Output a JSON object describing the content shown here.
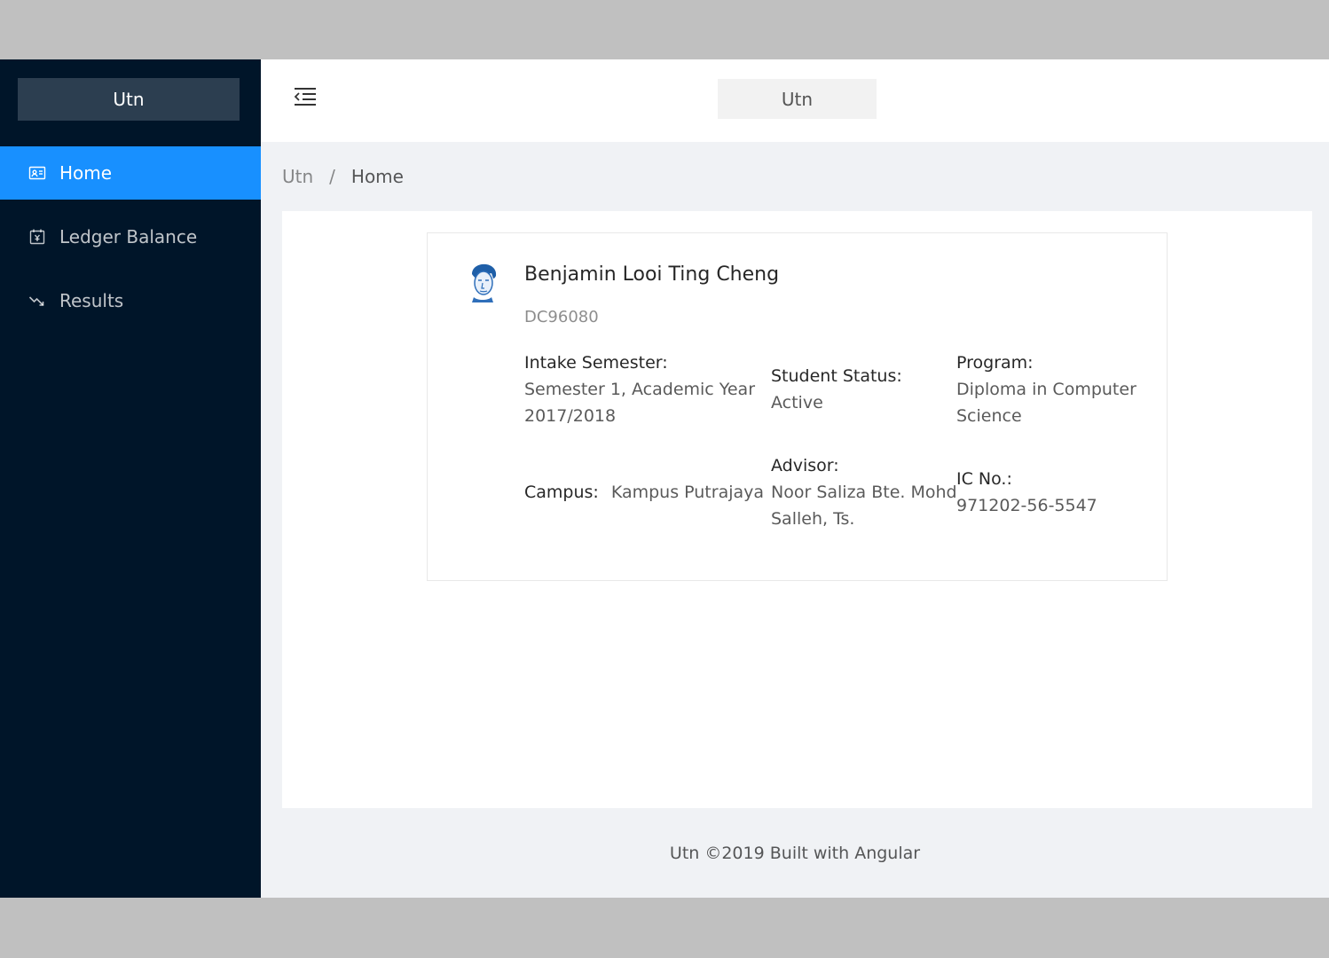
{
  "sidebar": {
    "logo": "Utn",
    "items": [
      {
        "label": "Home",
        "icon": "idcard-icon"
      },
      {
        "label": "Ledger Balance",
        "icon": "calendar-icon"
      },
      {
        "label": "Results",
        "icon": "fall-icon"
      }
    ]
  },
  "header": {
    "title": "Utn",
    "trigger_icon": "menu-fold-icon"
  },
  "breadcrumb": {
    "items": [
      "Utn",
      "Home"
    ],
    "separator": "/"
  },
  "profile": {
    "name": "Benjamin Looi Ting Cheng",
    "student_id": "DC96080",
    "intake_label": "Intake Semester:",
    "intake_value": "Semester 1, Academic Year 2017/2018",
    "status_label": "Student Status:",
    "status_value": "Active",
    "program_label": "Program:",
    "program_value": "Diploma in Computer Science",
    "campus_label": "Campus:",
    "campus_value": "Kampus Putrajaya",
    "advisor_label": "Advisor:",
    "advisor_value": "Noor Saliza Bte. Mohd Salleh, Ts.",
    "ic_label": "IC No.:",
    "ic_value": "971202-56-5547"
  },
  "footer": {
    "text": "Utn ©2019 Built with Angular"
  },
  "colors": {
    "sider_bg": "#001529",
    "active_bg": "#1890ff",
    "logo_bg": "#2c3e50",
    "content_bg": "#f0f2f5"
  }
}
